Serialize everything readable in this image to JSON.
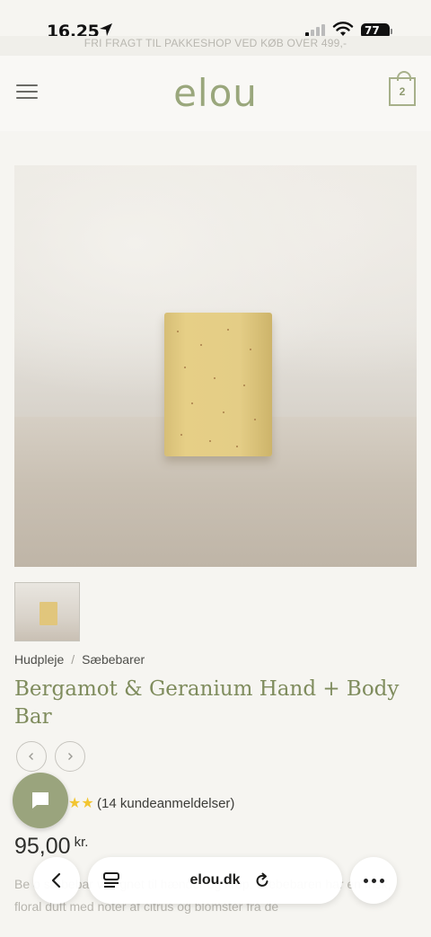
{
  "status": {
    "time": "16.25",
    "battery": "77"
  },
  "banner": {
    "text": "FRI FRAGT TIL PAKKESHOP VED KØB OVER 499,-"
  },
  "header": {
    "logo": "elou",
    "cart_count": "2"
  },
  "breadcrumb": {
    "items": [
      "Hudpleje",
      "Sæbebarer"
    ]
  },
  "product": {
    "title": "Bergamot & Geranium Hand + Body Bar",
    "rating_stars": "★★",
    "reviews": "(14 kundeanmeldelser)",
    "price": "95,00",
    "currency": "kr.",
    "description": "Be                                                         o sæbebar velegnet til hænder og krop. Sæbebaren har en frisk, floral duft med noter af citrus og blomster fra de"
  },
  "browser": {
    "domain": "elou.dk"
  },
  "colors": {
    "accent": "#9aa77c",
    "title": "#7f8c5d",
    "star": "#f2c531"
  },
  "icons": [
    "location-arrow-icon",
    "signal-icon",
    "wifi-icon",
    "menu-icon",
    "cart-icon",
    "chevron-left-icon",
    "chevron-right-icon",
    "chat-icon",
    "back-icon",
    "tabs-icon",
    "reload-icon",
    "more-icon"
  ]
}
